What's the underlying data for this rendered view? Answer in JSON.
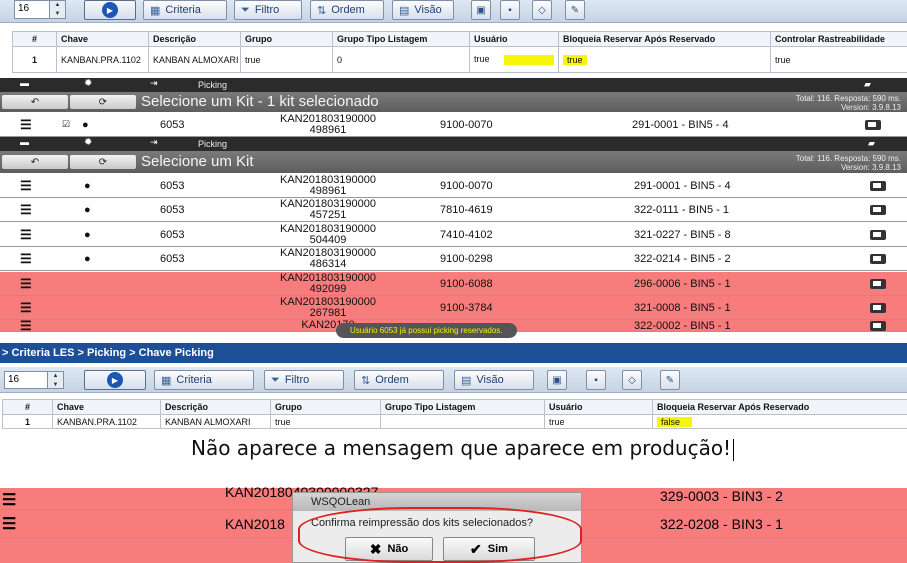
{
  "top_toolbar": {
    "page_size": "16",
    "buttons": [
      "Criteria",
      "Filtro",
      "Ordem",
      "Visão"
    ]
  },
  "top_table": {
    "headers": [
      "#",
      "Chave",
      "Descrição",
      "Grupo",
      "Grupo Tipo Listagem",
      "Usuário",
      "Bloqueia Reservar Após Reservado",
      "Controlar Rastreabilidade"
    ],
    "row": [
      "1",
      "KANBAN.PRA.1102",
      "KANBAN ALMOXARI",
      "true",
      "0",
      "true",
      "true",
      "true"
    ]
  },
  "app1": {
    "tab": "Picking",
    "title": "Selecione um Kit - 1 kit selecionado",
    "info_total": "Total: 116. Resposta: 590 ms.",
    "info_version": "Version: 3.9.8.13",
    "rows": [
      {
        "user": "6053",
        "kan1": "KAN201803190000",
        "kan2": "498961",
        "part": "9100-0070",
        "bin": "291-0001 - BIN5 - 4"
      }
    ]
  },
  "app2": {
    "tab": "Picking",
    "title": "Selecione um Kit",
    "info_total": "Total: 116. Resposta: 590 ms.",
    "info_version": "Version: 3.9.8.13",
    "rows": [
      {
        "user": "6053",
        "kan1": "KAN201803190000",
        "kan2": "498961",
        "part": "9100-0070",
        "bin": "291-0001 - BIN5 - 4"
      },
      {
        "user": "6053",
        "kan1": "KAN201803190000",
        "kan2": "457251",
        "part": "7810-4619",
        "bin": "322-0111 - BIN5 - 1"
      },
      {
        "user": "6053",
        "kan1": "KAN201803190000",
        "kan2": "504409",
        "part": "7410-4102",
        "bin": "321-0227 - BIN5 - 8"
      },
      {
        "user": "6053",
        "kan1": "KAN201803190000",
        "kan2": "486314",
        "part": "9100-0298",
        "bin": "322-0214 - BIN5 - 2"
      },
      {
        "user": "",
        "kan1": "KAN201803190000",
        "kan2": "492099",
        "part": "9100-6088",
        "bin": "296-0006 - BIN5 - 1"
      },
      {
        "user": "",
        "kan1": "KAN201803190000",
        "kan2": "267981",
        "part": "9100-3784",
        "bin": "321-0008 - BIN5 - 1"
      },
      {
        "user": "",
        "kan1": "KAN20170",
        "kan2": "",
        "part": "",
        "bin": "322-0002 - BIN5 - 1"
      }
    ],
    "toast": "Usuário 6053 já possui picking reservados."
  },
  "breadcrumb": "> Criteria LES > Picking > Chave Picking",
  "bottom_toolbar": {
    "page_size": "16",
    "buttons": [
      "Criteria",
      "Filtro",
      "Ordem",
      "Visão"
    ]
  },
  "bottom_table": {
    "headers": [
      "#",
      "Chave",
      "Descrição",
      "Grupo",
      "Grupo Tipo Listagem",
      "Usuário",
      "Bloqueia Reservar Após Reservado"
    ],
    "row": [
      "1",
      "KANBAN.PRA.1102",
      "KANBAN ALMOXARI",
      "true",
      "",
      "true",
      "false"
    ]
  },
  "note": "Não aparece a mensagem que aparece em produção!",
  "app3": {
    "rows": [
      {
        "kan": "KAN2018040300000327",
        "bin": "329-0003 - BIN3 - 2"
      },
      {
        "kan": "KAN2018",
        "bin": "322-0208 - BIN3 - 1"
      }
    ]
  },
  "dialog": {
    "title": "WSQOLean",
    "message": "Confirma reimpressão dos kits selecionados?",
    "no": "Não",
    "yes": "Sim"
  }
}
